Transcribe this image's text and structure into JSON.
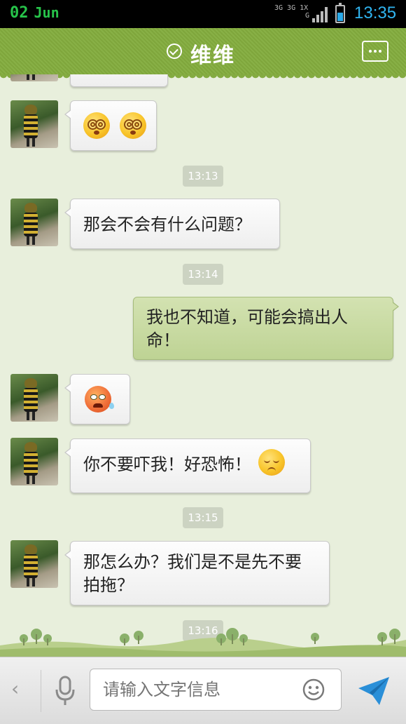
{
  "status_bar": {
    "day": "02",
    "month": "Jun",
    "network_top": "3G 3G 1X",
    "network_bottom": "G",
    "time": "13:35",
    "battery_level": 0.55
  },
  "title_bar": {
    "title": "维维"
  },
  "chat": {
    "messages": [
      {
        "side": "left",
        "type": "emoji",
        "emojis": [
          "dizzy",
          "dizzy"
        ]
      },
      {
        "type": "time",
        "text": "13:13"
      },
      {
        "side": "left",
        "type": "text",
        "text": "那会不会有什么问题？"
      },
      {
        "type": "time",
        "text": "13:14"
      },
      {
        "side": "right",
        "type": "text",
        "text": "我也不知道，可能会搞出人命！"
      },
      {
        "side": "left",
        "type": "emoji",
        "emojis": [
          "angry-sweat"
        ]
      },
      {
        "side": "left",
        "type": "text",
        "text": "你不要吓我！好恐怖！",
        "trailing_emoji": "sad"
      },
      {
        "type": "time",
        "text": "13:15"
      },
      {
        "side": "left",
        "type": "text",
        "text": "那怎么办？我们是不是先不要拍拖？"
      },
      {
        "type": "time",
        "text": "13:16"
      }
    ]
  },
  "input_bar": {
    "placeholder": "请输入文字信息"
  },
  "colors": {
    "title_bar": "#84ab41",
    "background": "#e8efdc",
    "own_bubble": "#c7dba0",
    "time_accent": "#30b4f0"
  }
}
